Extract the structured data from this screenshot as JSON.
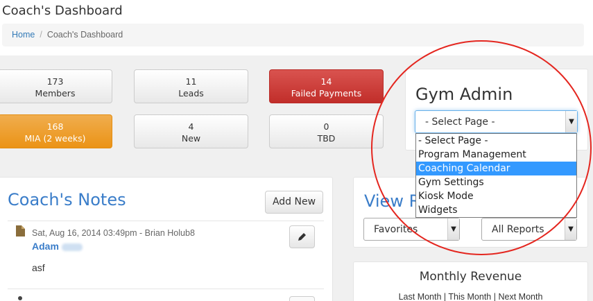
{
  "header": {
    "title": "Coach's Dashboard"
  },
  "breadcrumb": {
    "home": "Home",
    "separator": "/",
    "current": "Coach's Dashboard"
  },
  "tiles": [
    {
      "value": "173",
      "label": "Members"
    },
    {
      "value": "11",
      "label": "Leads"
    },
    {
      "value": "14",
      "label": "Failed Payments"
    },
    {
      "value": "168",
      "label": "MIA (2 weeks)"
    },
    {
      "value": "4",
      "label": "New"
    },
    {
      "value": "0",
      "label": "TBD"
    }
  ],
  "colors": {
    "danger": "#d9534f",
    "warning": "#f0ad4e",
    "link": "#337ab7",
    "highlight": "#3399ff",
    "annotation": "#e4261f"
  },
  "gym_admin": {
    "title": "Gym Admin",
    "select_value": "- Select Page -",
    "options": [
      "- Select Page -",
      "Program Management",
      "Coaching Calendar",
      "Gym Settings",
      "Kiosk Mode",
      "Widgets"
    ],
    "highlighted_option": "Coaching Calendar"
  },
  "notes": {
    "title": "Coach's Notes",
    "add_label": "Add New",
    "items": [
      {
        "meta_date": "Sat, Aug 16, 2014 03:49pm",
        "meta_sep": " - ",
        "meta_author": "Brian Holub8",
        "name": "Adam",
        "body": "asf"
      }
    ]
  },
  "reports": {
    "title": "View R",
    "favorites": "Favorites",
    "all_reports": "All Reports"
  },
  "revenue": {
    "title": "Monthly Revenue",
    "links": [
      "Last Month",
      "This Month",
      "Next Month"
    ],
    "link_sep": "|"
  },
  "icons": {
    "note": "file-icon",
    "edit": "pencil-icon",
    "person": "user-icon"
  }
}
